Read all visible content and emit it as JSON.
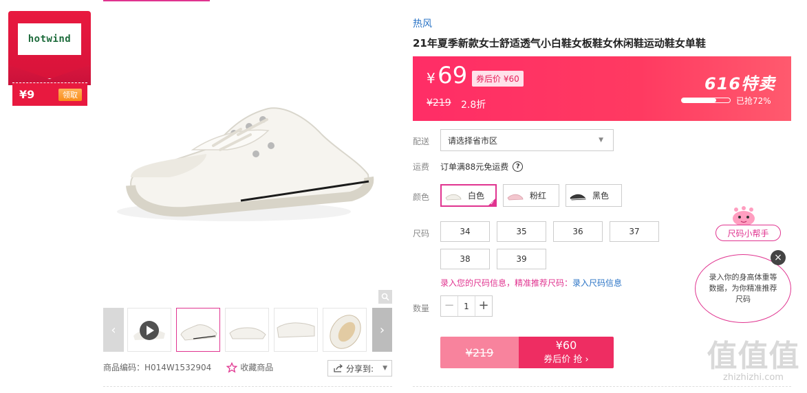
{
  "coupon": {
    "brand_logo": "hotwind",
    "amount": "¥9",
    "claim": "领取"
  },
  "product": {
    "brand": "热风",
    "title": "21年夏季新款女士舒适透气小白鞋女板鞋女休闲鞋运动鞋女单鞋",
    "sku_label": "商品编码：H014W1532904",
    "favorite_label": "收藏商品",
    "share_label": "分享到:"
  },
  "price": {
    "currency": "¥",
    "amount": "69",
    "coupon_tag": "券后价 ¥60",
    "original": "¥219",
    "discount": "2.8折",
    "promo": "616特卖",
    "sold_text": "已抢72%",
    "sold_progress": 0.72
  },
  "delivery": {
    "label": "配送",
    "placeholder": "请选择省市区"
  },
  "shipping": {
    "label": "运费",
    "text": "订单满88元免运费"
  },
  "colors": {
    "label": "颜色",
    "options": [
      {
        "name": "白色",
        "swatch": "#f1efe9"
      },
      {
        "name": "粉红",
        "swatch": "#f3c6ce"
      },
      {
        "name": "黑色",
        "swatch": "#3a3a3a"
      }
    ],
    "selected": "白色"
  },
  "sizes": {
    "label": "尺码",
    "options": [
      "34",
      "35",
      "36",
      "37",
      "38",
      "39"
    ]
  },
  "size_hint": {
    "pink": "录入您的尺码信息，精准推荐尺码：",
    "link": "录入尺码信息"
  },
  "quantity": {
    "label": "数量",
    "value": "1"
  },
  "buy": {
    "original": "¥219",
    "coupon_price": "¥60",
    "coupon_label": "券后价 抢 ›"
  },
  "helper": {
    "button": "尺码小帮手",
    "bubble": "录入你的身高体重等数据，为你精准推荐尺码"
  },
  "watermark": {
    "big": "值值值",
    "small": "zhizhizhi.com"
  }
}
